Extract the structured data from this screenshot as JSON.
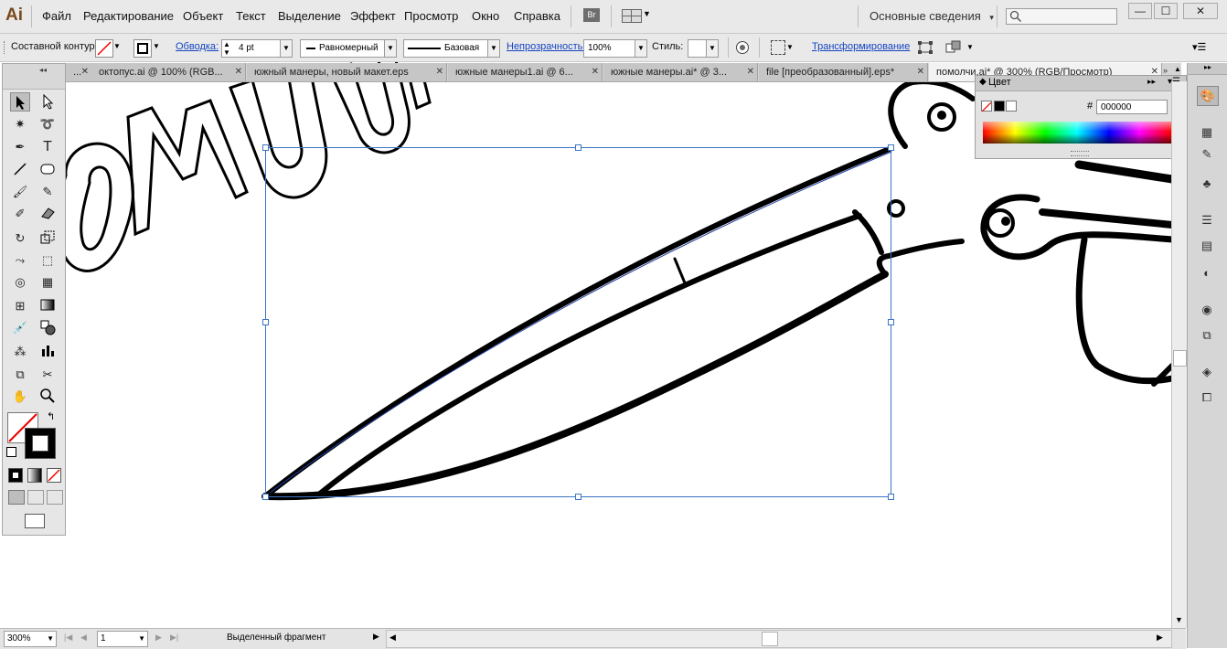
{
  "app": {
    "logo": "Ai",
    "menu": [
      "Файл",
      "Редактирование",
      "Объект",
      "Текст",
      "Выделение",
      "Эффект",
      "Просмотр",
      "Окно",
      "Справка"
    ],
    "bridge_label": "Br",
    "workspace": "Основные сведения",
    "workspace_arrow": "▾",
    "window_buttons": [
      "—",
      "☐",
      "✕"
    ]
  },
  "control_bar": {
    "object_type": "Составной контур",
    "stroke_label": "Обводка:",
    "stroke_weight": "4 pt",
    "profile_uniform": "Равномерный",
    "brush_basic": "Базовая",
    "opacity_label": "Непрозрачность:",
    "opacity_value": "100%",
    "style_label": "Стиль:",
    "transform_label": "Трансформирование"
  },
  "tabs": [
    {
      "label": "...",
      "active": false
    },
    {
      "label": "октопус.ai @ 100% (RGB...",
      "active": false
    },
    {
      "label": "южный манеры, новый макет.eps",
      "active": false
    },
    {
      "label": "южные манеры1.ai @ 6...",
      "active": false
    },
    {
      "label": "южные манеры.ai* @ 3...",
      "active": false
    },
    {
      "label": "file [преобразованный].eps*",
      "active": false
    },
    {
      "label": "помолчи.ai* @ 300% (RGB/Просмотр)",
      "active": true
    }
  ],
  "tab_close": "✕",
  "color_panel": {
    "title": "Цвет",
    "hex_label": "#",
    "hex_value": "000000"
  },
  "status": {
    "zoom": "300%",
    "artboard": "1",
    "selection_info": "Выделенный фрагмент"
  },
  "canvas": {
    "artwork_text": "ПОМОЛЧИ"
  }
}
